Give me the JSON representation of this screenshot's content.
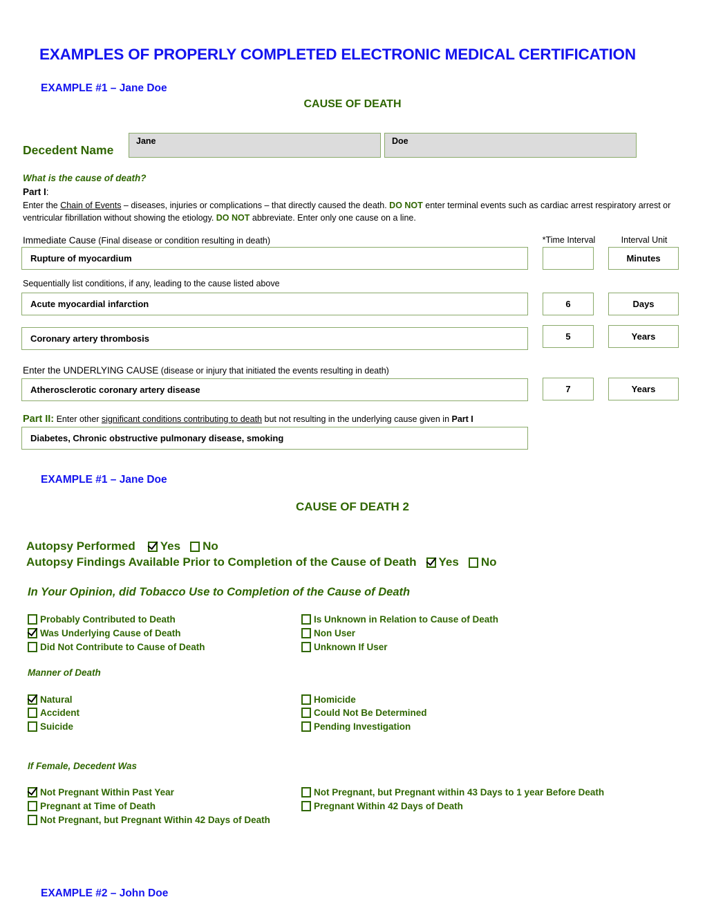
{
  "document": {
    "title": "EXAMPLES OF PROPERLY COMPLETED ELECTRONIC MEDICAL CERTIFICATION",
    "title_color": "#1414ee",
    "accent_green": "#2f6601",
    "border_green": "#8aaa6a",
    "field_fill": "#dcdcdc"
  },
  "section1": {
    "example_label": "EXAMPLE #1 – Jane Doe",
    "heading": "CAUSE OF DEATH",
    "decedent_name_label": "Decedent Name",
    "first_name": "Jane",
    "last_name": "Doe",
    "question": "What is the cause of death?",
    "part_i_label": "Part I",
    "part_i_colon": ":",
    "instructions": {
      "seg1": "Enter the ",
      "underline1": "Chain of Events",
      "seg2": " – diseases, injuries or complications – that directly caused the death.  ",
      "donot1": "DO NOT",
      "seg3": " enter terminal events such as cardiac arrest respiratory arrest or ventricular fibrillation without showing the etiology.  ",
      "donot2": "DO NOT",
      "seg4": " abbreviate.  Enter only one cause on a line."
    },
    "columns": {
      "time_interval": "*Time Interval",
      "interval_unit": "Interval Unit"
    },
    "immediate_cause_caption": "Immediate Cause",
    "immediate_cause_paren": "(Final disease or condition resulting in death)",
    "sequential_caption": "Sequentially list conditions, if any, leading to the cause listed above",
    "underlying_caption": "Enter the UNDERLYING CAUSE",
    "underlying_paren": "(disease or injury that initiated the events resulting in death)",
    "rows": [
      {
        "cause": "Rupture of myocardium",
        "interval": "",
        "unit": "Minutes"
      },
      {
        "cause": "Acute myocardial infarction",
        "interval": "6",
        "unit": "Days"
      },
      {
        "cause": "Coronary artery thrombosis",
        "interval": "5",
        "unit": "Years"
      },
      {
        "cause": "Atherosclerotic coronary artery disease",
        "interval": "7",
        "unit": "Years"
      }
    ],
    "part_ii": {
      "label": "Part II:",
      "seg1": " Enter other ",
      "underline": "significant conditions contributing to death",
      "seg2": " but not resulting in the underlying cause given in ",
      "bold": "Part I",
      "value": "Diabetes, Chronic obstructive pulmonary disease, smoking"
    }
  },
  "section2": {
    "example_label": "EXAMPLE #1 – Jane Doe",
    "heading": "CAUSE OF DEATH 2",
    "autopsy_performed": {
      "label": "Autopsy Performed",
      "yes": "Yes",
      "no": "No",
      "yes_checked": true,
      "no_checked": false
    },
    "autopsy_findings": {
      "label": "Autopsy Findings Available Prior to Completion of the Cause of Death",
      "yes": "Yes",
      "no": "No",
      "yes_checked": true,
      "no_checked": false
    },
    "tobacco": {
      "heading": "In Your Opinion, did Tobacco Use to Completion of the Cause of Death",
      "left": [
        {
          "label": "Probably Contributed to Death",
          "checked": false
        },
        {
          "label": "Was Underlying Cause of Death",
          "checked": true
        },
        {
          "label": "Did Not Contribute to Cause of Death",
          "checked": false
        }
      ],
      "right": [
        {
          "label": "Is Unknown in Relation to Cause of Death",
          "checked": false
        },
        {
          "label": "Non User",
          "checked": false
        },
        {
          "label": "Unknown If User",
          "checked": false
        }
      ]
    },
    "manner": {
      "heading": "Manner of Death",
      "left": [
        {
          "label": "Natural",
          "checked": true
        },
        {
          "label": "Accident",
          "checked": false
        },
        {
          "label": "Suicide",
          "checked": false
        }
      ],
      "right": [
        {
          "label": "Homicide",
          "checked": false
        },
        {
          "label": "Could Not Be Determined",
          "checked": false
        },
        {
          "label": "Pending Investigation",
          "checked": false
        }
      ]
    },
    "female": {
      "heading": "If Female, Decedent Was",
      "left": [
        {
          "label": "Not Pregnant Within Past Year",
          "checked": true
        },
        {
          "label": "Pregnant at Time of Death",
          "checked": false
        },
        {
          "label": "Not Pregnant, but Pregnant Within 42 Days of Death",
          "checked": false
        }
      ],
      "right": [
        {
          "label": "Not Pregnant, but Pregnant within 43 Days to 1 year Before Death",
          "checked": false
        },
        {
          "label": "Pregnant Within 42 Days of Death",
          "checked": false
        }
      ]
    }
  },
  "section3": {
    "example_label": "EXAMPLE #2 – John Doe"
  }
}
